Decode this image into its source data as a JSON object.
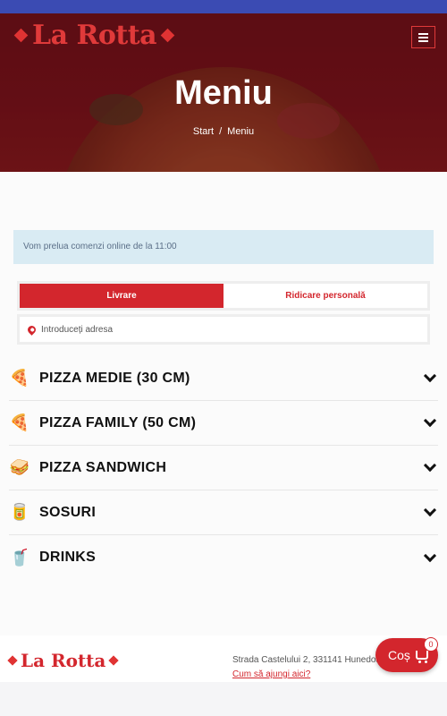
{
  "header": {
    "logo_text": "La Rotta",
    "page_title": "Meniu",
    "breadcrumb": {
      "home": "Start",
      "separator": "/",
      "current": "Meniu"
    }
  },
  "notice": "Vom prelua comenzi online de la 11:00",
  "order_tabs": {
    "delivery": "Livrare",
    "pickup": "Ridicare personală",
    "active": "delivery"
  },
  "address": {
    "placeholder": "Introduceți adresa",
    "icon": "location-pin-icon"
  },
  "categories": [
    {
      "label": "PIZZA MEDIE (30 CM)",
      "icon": "pizza-slice-icon",
      "glyph": "🍕"
    },
    {
      "label": "PIZZA FAMILY (50 CM)",
      "icon": "whole-pizza-icon",
      "glyph": "🍕"
    },
    {
      "label": "PIZZA SANDWICH",
      "icon": "sandwich-icon",
      "glyph": "🥪"
    },
    {
      "label": "SOSURI",
      "icon": "sauce-bottle-icon",
      "glyph": "🥫"
    },
    {
      "label": "DRINKS",
      "icon": "drink-cup-icon",
      "glyph": "🥤"
    }
  ],
  "footer": {
    "logo_text": "La Rotta",
    "address": "Strada Castelului 2, 331141 Hunedoara",
    "directions_link": "Cum să ajungi aici?"
  },
  "cart": {
    "label": "Coș",
    "count": "0"
  },
  "colors": {
    "brand_red": "#d3262d",
    "top_bar": "#3b4bb3",
    "notice_bg": "#d9ebf3"
  }
}
